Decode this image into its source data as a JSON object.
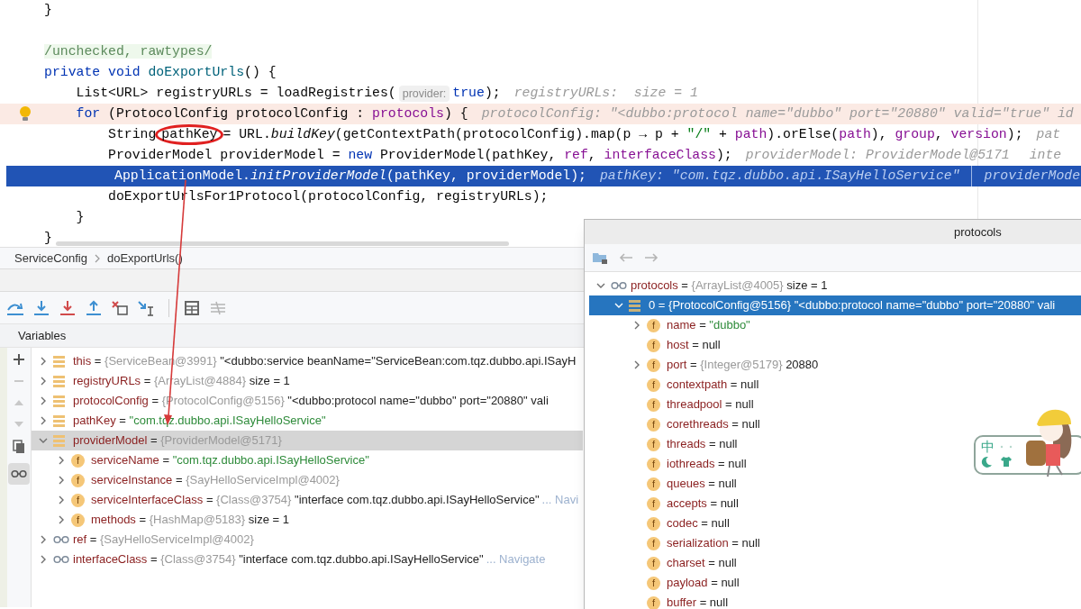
{
  "editor": {
    "lines": [
      {
        "selected": false,
        "marked": false,
        "segments": [
          {
            "kind": "code",
            "tokens": [
              {
                "text": "}",
                "kind": "plain"
              }
            ]
          }
        ]
      },
      {
        "selected": false,
        "marked": false
      },
      {
        "selected": false,
        "marked": false,
        "segments": [
          {
            "kind": "code",
            "tokens": [
              {
                "text": "/unchecked, rawtypes/",
                "kind": "comment"
              }
            ]
          }
        ]
      },
      {
        "selected": false,
        "marked": false,
        "segments": [
          {
            "kind": "code",
            "tokens": [
              {
                "text": "private",
                "kind": "keyword"
              },
              {
                "text": " void",
                "kind": "keyword"
              },
              {
                "text": " doExportUrls",
                "kind": "method"
              },
              {
                "text": "() {",
                "kind": "plain"
              }
            ]
          }
        ]
      },
      {
        "selected": false,
        "marked": false,
        "segments": [
          {
            "kind": "code",
            "tokens": [
              {
                "text": "    List<URL> registryURLs = loadRegistries(",
                "kind": "plain"
              }
            ]
          },
          {
            "kind": "param_hint",
            "text": "provider:"
          },
          {
            "kind": "code",
            "tokens": [
              {
                "text": "true",
                "kind": "keyword"
              },
              {
                "text": ");",
                "kind": "plain"
              }
            ]
          },
          {
            "kind": "value_hint",
            "text": "registryURLs:  size = 1"
          }
        ]
      },
      {
        "selected": false,
        "marked": true,
        "intention_bulb": true,
        "segments": [
          {
            "kind": "code",
            "tokens": [
              {
                "text": "    for",
                "kind": "keyword"
              },
              {
                "text": " (ProtocolConfig protocolConfig : ",
                "kind": "plain"
              },
              {
                "text": "protocols",
                "kind": "field"
              },
              {
                "text": ") {",
                "kind": "plain"
              }
            ]
          },
          {
            "kind": "value_hint",
            "text": "protocolConfig: \"<dubbo:protocol name=\"dubbo\" port=\"20880\" valid=\"true\" id"
          }
        ]
      },
      {
        "selected": false,
        "marked": false,
        "segments": [
          {
            "kind": "code",
            "tokens": [
              {
                "text": "        String",
                "kind": "plain"
              }
            ]
          },
          {
            "kind": "circled",
            "text": "pathKey"
          },
          {
            "kind": "code",
            "tokens": [
              {
                "text": "= URL.",
                "kind": "plain"
              },
              {
                "text": "buildKey",
                "kind": "static_call"
              },
              {
                "text": "(getContextPath(protocolConfig).map(p → p + ",
                "kind": "plain"
              },
              {
                "text": "\"/\"",
                "kind": "string"
              },
              {
                "text": " + ",
                "kind": "plain"
              },
              {
                "text": "path",
                "kind": "field"
              },
              {
                "text": ").orElse(",
                "kind": "plain"
              },
              {
                "text": "path",
                "kind": "field"
              },
              {
                "text": "), ",
                "kind": "plain"
              },
              {
                "text": "group",
                "kind": "field"
              },
              {
                "text": ", ",
                "kind": "plain"
              },
              {
                "text": "version",
                "kind": "field"
              },
              {
                "text": ");",
                "kind": "plain"
              }
            ]
          },
          {
            "kind": "value_hint",
            "text": "pat"
          }
        ]
      },
      {
        "selected": false,
        "marked": false,
        "segments": [
          {
            "kind": "code",
            "tokens": [
              {
                "text": "        ProviderModel providerModel = ",
                "kind": "plain"
              },
              {
                "text": "new",
                "kind": "keyword"
              },
              {
                "text": " ProviderModel(pathKey, ",
                "kind": "plain"
              },
              {
                "text": "ref",
                "kind": "field"
              },
              {
                "text": ", ",
                "kind": "plain"
              },
              {
                "text": "interfaceClass",
                "kind": "field"
              },
              {
                "text": ");",
                "kind": "plain"
              }
            ]
          },
          {
            "kind": "value_hint",
            "text": "providerModel: ProviderModel@5171"
          },
          {
            "kind": "value_hint",
            "text": "inte"
          }
        ]
      },
      {
        "selected": true,
        "marked": false,
        "segments": [
          {
            "kind": "code",
            "tokens": [
              {
                "text": "        ApplicationModel.",
                "kind": "plain"
              },
              {
                "text": "initProviderModel",
                "kind": "static_call"
              },
              {
                "text": "(pathKey, providerModel);",
                "kind": "plain"
              }
            ]
          },
          {
            "kind": "value_hint",
            "text": "pathKey: \"com.tqz.dubbo.api.ISayHelloService\""
          },
          {
            "kind": "value_hint",
            "text": "providerMode"
          }
        ]
      },
      {
        "selected": false,
        "marked": false,
        "segments": [
          {
            "kind": "code",
            "tokens": [
              {
                "text": "        doExportUrlsFor1Protocol(protocolConfig, registryURLs);",
                "kind": "plain"
              }
            ]
          }
        ]
      },
      {
        "selected": false,
        "marked": false,
        "segments": [
          {
            "kind": "code",
            "tokens": [
              {
                "text": "    }",
                "kind": "plain"
              }
            ]
          }
        ]
      },
      {
        "selected": false,
        "marked": false,
        "segments": [
          {
            "kind": "code",
            "tokens": [
              {
                "text": "}",
                "kind": "plain"
              }
            ]
          }
        ]
      }
    ]
  },
  "breadcrumb": [
    "ServiceConfig",
    "doExportUrls()"
  ],
  "variables": {
    "title": "Variables",
    "tree": [
      {
        "kind": "variable",
        "name": "this",
        "sep": "=",
        "ref": "{ServiceBean@3991}",
        "value": "\"<dubbo:service beanName=\"ServiceBean:com.tqz.dubbo.api.ISayH",
        "string": false,
        "expanded": false,
        "selected": false
      },
      {
        "kind": "variable",
        "name": "registryURLs",
        "sep": "=",
        "ref": "{ArrayList@4884}",
        "value": "size = 1",
        "string": false,
        "expanded": false,
        "selected": false
      },
      {
        "kind": "variable",
        "name": "protocolConfig",
        "sep": "=",
        "ref": "{ProtocolConfig@5156}",
        "value": "\"<dubbo:protocol name=\"dubbo\" port=\"20880\" vali",
        "string": false,
        "expanded": false,
        "selected": false
      },
      {
        "kind": "variable",
        "name": "pathKey",
        "sep": "=",
        "value": "\"com.tqz.dubbo.api.ISayHelloService\"",
        "string": true,
        "expanded": false,
        "selected": false
      },
      {
        "kind": "variable",
        "name": "providerModel",
        "sep": "=",
        "ref": "{ProviderModel@5171}",
        "expanded": true,
        "selected": true,
        "children": [
          {
            "kind": "field",
            "icon_text": "f",
            "name": "serviceName",
            "sep": "=",
            "value": "\"com.tqz.dubbo.api.ISayHelloService\"",
            "string": true,
            "expanded": false,
            "selected": false
          },
          {
            "kind": "field",
            "icon_text": "f",
            "name": "serviceInstance",
            "sep": "=",
            "ref": "{SayHelloServiceImpl@4002}",
            "expanded": false,
            "selected": false
          },
          {
            "kind": "field",
            "icon_text": "f",
            "name": "serviceInterfaceClass",
            "sep": "=",
            "ref": "{Class@3754}",
            "value": "\"interface com.tqz.dubbo.api.ISayHelloService\"",
            "string": false,
            "link": "... Navi",
            "expanded": false,
            "selected": false
          },
          {
            "kind": "field",
            "icon_text": "f",
            "name": "methods",
            "sep": "=",
            "ref": "{HashMap@5183}",
            "value": "size = 1",
            "string": false,
            "expanded": false,
            "selected": false
          }
        ]
      },
      {
        "kind": "watch",
        "name": "ref",
        "sep": "=",
        "ref": "{SayHelloServiceImpl@4002}",
        "expanded": false,
        "selected": false
      },
      {
        "kind": "watch",
        "name": "interfaceClass",
        "sep": "=",
        "ref": "{Class@3754}",
        "value": "\"interface com.tqz.dubbo.api.ISayHelloService\"",
        "string": false,
        "link": "... Navigate",
        "expanded": false,
        "selected": false
      }
    ]
  },
  "popup": {
    "title": "protocols",
    "tree": [
      {
        "kind": "watch",
        "name": "protocols",
        "sep": "=",
        "ref": "{ArrayList@4005}",
        "value": "size = 1",
        "string": false,
        "expanded": true,
        "selected": false,
        "children": [
          {
            "kind": "array",
            "name": "0",
            "sep": "=",
            "ref": "{ProtocolConfig@5156}",
            "value": "\"<dubbo:protocol name=\"dubbo\" port=\"20880\" vali",
            "string": false,
            "expanded": true,
            "selected": true,
            "children": [
              {
                "kind": "field",
                "icon_text": "f",
                "name": "name",
                "sep": "=",
                "value": "\"dubbo\"",
                "string": true,
                "expanded": false,
                "selected": false
              },
              {
                "kind": "field",
                "icon_text": "f",
                "name": "host",
                "sep": "=",
                "value": "null",
                "string": false,
                "selected": false
              },
              {
                "kind": "field",
                "icon_text": "f",
                "name": "port",
                "sep": "=",
                "ref": "{Integer@5179}",
                "value": "20880",
                "string": false,
                "expanded": false,
                "selected": false
              },
              {
                "kind": "field",
                "icon_text": "f",
                "name": "contextpath",
                "sep": "=",
                "value": "null",
                "string": false,
                "selected": false
              },
              {
                "kind": "field",
                "icon_text": "f",
                "name": "threadpool",
                "sep": "=",
                "value": "null",
                "string": false,
                "selected": false
              },
              {
                "kind": "field",
                "icon_text": "f",
                "name": "corethreads",
                "sep": "=",
                "value": "null",
                "string": false,
                "selected": false
              },
              {
                "kind": "field",
                "icon_text": "f",
                "name": "threads",
                "sep": "=",
                "value": "null",
                "string": false,
                "selected": false
              },
              {
                "kind": "field",
                "icon_text": "f",
                "name": "iothreads",
                "sep": "=",
                "value": "null",
                "string": false,
                "selected": false
              },
              {
                "kind": "field",
                "icon_text": "f",
                "name": "queues",
                "sep": "=",
                "value": "null",
                "string": false,
                "selected": false
              },
              {
                "kind": "field",
                "icon_text": "f",
                "name": "accepts",
                "sep": "=",
                "value": "null",
                "string": false,
                "selected": false
              },
              {
                "kind": "field",
                "icon_text": "f",
                "name": "codec",
                "sep": "=",
                "value": "null",
                "string": false,
                "selected": false
              },
              {
                "kind": "field",
                "icon_text": "f",
                "name": "serialization",
                "sep": "=",
                "value": "null",
                "string": false,
                "selected": false
              },
              {
                "kind": "field",
                "icon_text": "f",
                "name": "charset",
                "sep": "=",
                "value": "null",
                "string": false,
                "selected": false
              },
              {
                "kind": "field",
                "icon_text": "f",
                "name": "payload",
                "sep": "=",
                "value": "null",
                "string": false,
                "selected": false
              },
              {
                "kind": "field",
                "icon_text": "f",
                "name": "buffer",
                "sep": "=",
                "value": "null",
                "string": false,
                "selected": false
              }
            ]
          }
        ]
      }
    ]
  },
  "ime_widget": {
    "mode": "中"
  }
}
